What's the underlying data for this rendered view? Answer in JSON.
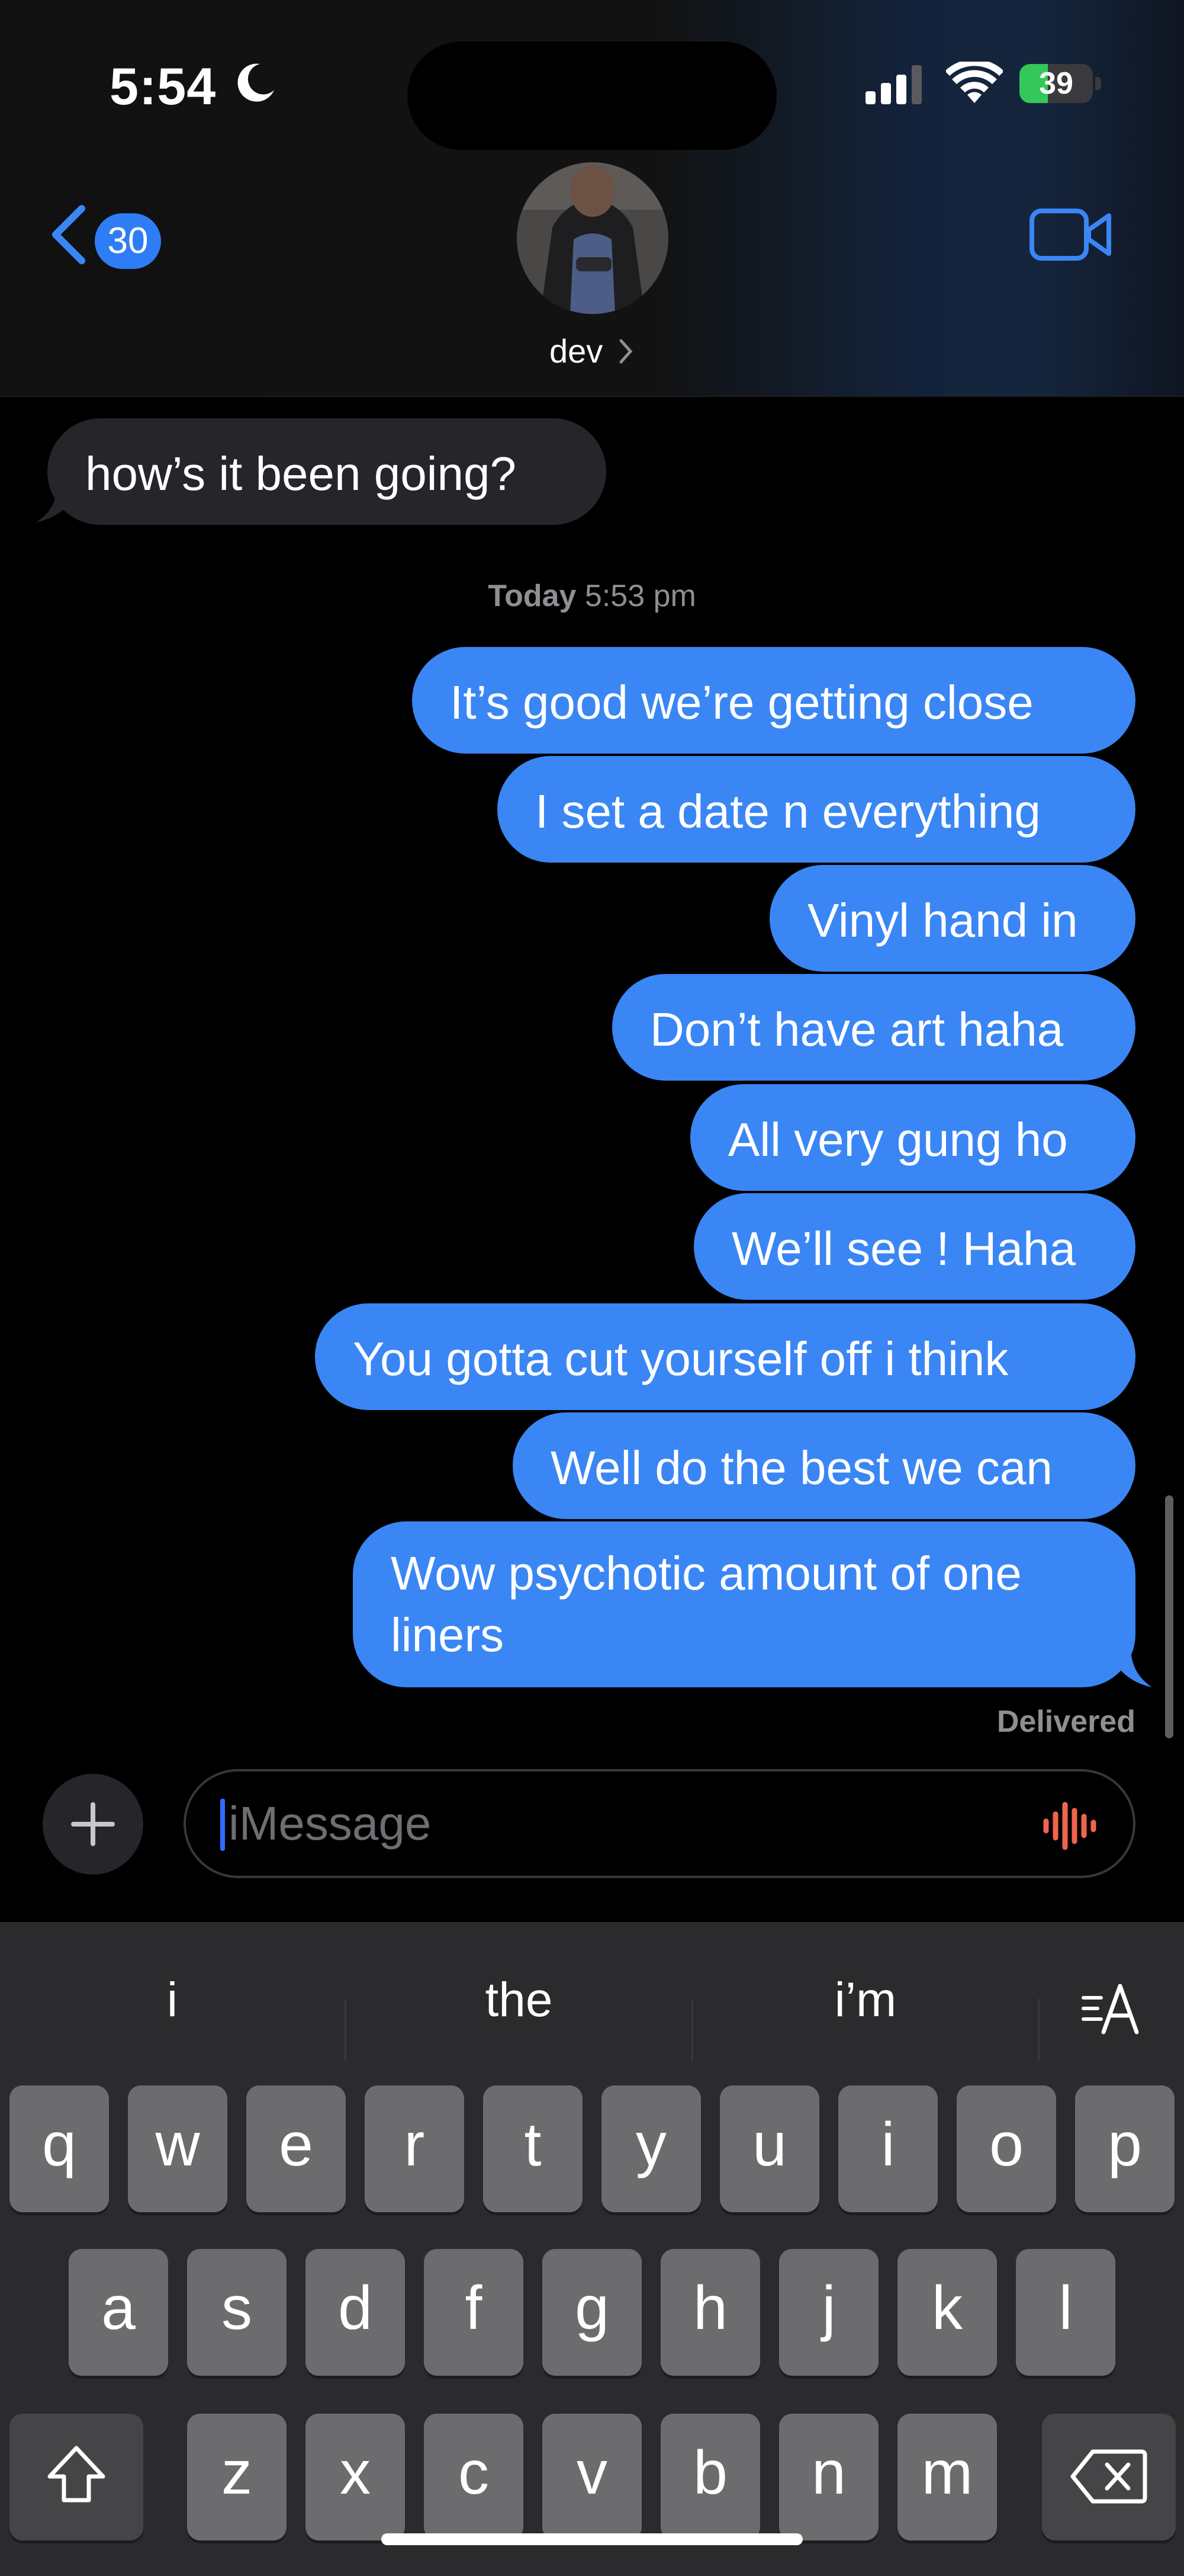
{
  "status_bar": {
    "time": "5:54",
    "battery": "39",
    "battery_level": 0.39
  },
  "header": {
    "back_count": "30",
    "contact_name": "dev"
  },
  "conversation": {
    "incoming": [
      {
        "text": "how’s it been going?"
      }
    ],
    "timestamp_day": "Today",
    "timestamp_time": "5:53 pm",
    "outgoing": [
      {
        "text": "It’s good we’re getting close"
      },
      {
        "text": "I set a date n everything"
      },
      {
        "text": "Vinyl hand in"
      },
      {
        "text": "Don’t have art haha"
      },
      {
        "text": "All very gung ho"
      },
      {
        "text": "We’ll see ! Haha"
      },
      {
        "text": "You gotta cut yourself off i think"
      },
      {
        "text": "Well do the best we can"
      },
      {
        "text": "Wow psychotic amount of one",
        "text2": "liners"
      }
    ],
    "delivered": "Delivered"
  },
  "compose": {
    "placeholder": "iMessage"
  },
  "keyboard": {
    "suggestions": [
      "i",
      "the",
      "i’m"
    ],
    "row1": [
      "q",
      "w",
      "e",
      "r",
      "t",
      "y",
      "u",
      "i",
      "o",
      "p"
    ],
    "row2": [
      "a",
      "s",
      "d",
      "f",
      "g",
      "h",
      "j",
      "k",
      "l"
    ],
    "row3": [
      "z",
      "x",
      "c",
      "v",
      "b",
      "n",
      "m"
    ]
  },
  "icons": {
    "moon": "moon-icon",
    "signal": "cellular-signal-icon",
    "wifi": "wifi-icon",
    "back": "chevron-left-icon",
    "video": "video-camera-icon",
    "plus": "plus-icon",
    "audio": "waveform-icon",
    "format": "text-format-icon",
    "shift": "shift-icon",
    "delete": "delete-icon"
  },
  "colors": {
    "accent_blue": "#3a86f5",
    "incoming_bubble": "#26252a",
    "battery_green": "#34c759",
    "waveform_red": "#f0644f"
  }
}
